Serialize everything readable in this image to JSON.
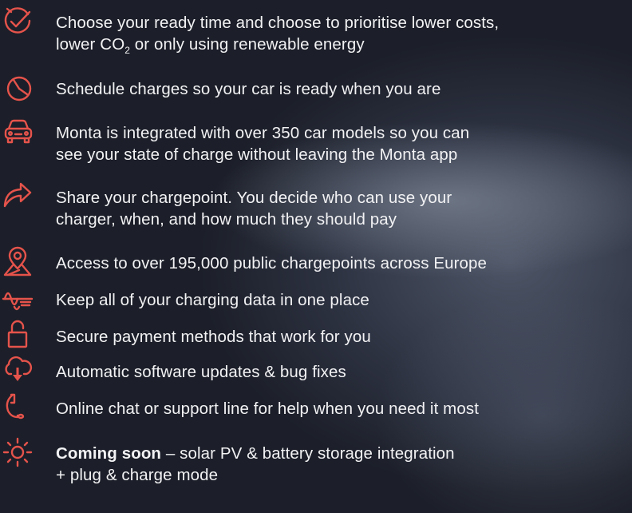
{
  "features": [
    {
      "icon": "clock-check-icon",
      "line1": "Choose your ready time and choose to prioritise lower costs,",
      "line2_a": "lower CO",
      "line2_sub": "2",
      "line2_b": " or only using renewable energy"
    },
    {
      "icon": "timer-icon",
      "text": "Schedule charges so your car is ready when you are"
    },
    {
      "icon": "car-icon",
      "line1": "Monta is integrated with over 350 car models so you can",
      "line2": "see your state of charge without leaving the Monta app"
    },
    {
      "icon": "share-arrow-icon",
      "line1": "Share your chargepoint. You decide who can use your",
      "line2": "charger, when, and how much they should pay"
    },
    {
      "icon": "map-pin-icon",
      "text": "Access to over 195,000 public chargepoints across Europe"
    },
    {
      "icon": "data-wave-icon",
      "text": "Keep all of your charging data in one place"
    },
    {
      "icon": "padlock-icon",
      "text": "Secure payment methods that work for you"
    },
    {
      "icon": "cloud-download-icon",
      "text": "Automatic software updates & bug fixes"
    },
    {
      "icon": "headset-icon",
      "text": "Online chat or support line for help when you need it most"
    },
    {
      "icon": "sun-icon",
      "bold": "Coming soon",
      "rest": " – solar PV & battery storage integration",
      "line2": "+ plug & charge mode"
    }
  ],
  "accent_color": "#e5534b",
  "text_color": "#f2f2f4",
  "background_color": "#1b1e27"
}
